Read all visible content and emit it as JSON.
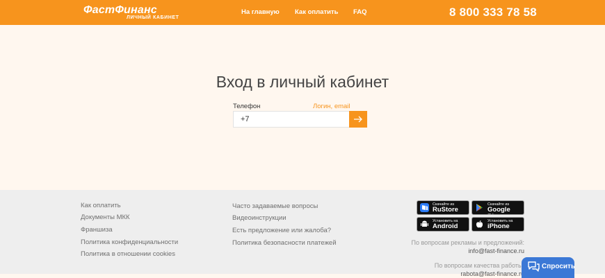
{
  "header": {
    "logo_main": "ФастФинанс",
    "logo_sub": "ЛИЧНЫЙ КАБИНЕТ",
    "nav": [
      "На главную",
      "Как оплатить",
      "FAQ"
    ],
    "phone": "8 800 333 78 58"
  },
  "login": {
    "title": "Вход в личный кабинет",
    "phone_label": "Телефон",
    "login_email_link": "Логин, email",
    "phone_value": "+7"
  },
  "footer": {
    "col1": [
      "Как оплатить",
      "Документы МКК",
      "Франшиза",
      "Политика конфиденциальности",
      "Политика в отношении cookies"
    ],
    "col2": [
      "Часто задаваемые вопросы",
      "Видеоинструкции",
      "Есть предложение или жалоба?",
      "Политика безопасности платежей"
    ],
    "stores": [
      {
        "small": "Скачайте из",
        "big": "RuStore",
        "icon": "rustore-icon"
      },
      {
        "small": "Скачайте из",
        "big": "Google Play",
        "icon": "google-play-icon"
      },
      {
        "small": "Установить на",
        "big": "Android",
        "icon": "android-icon"
      },
      {
        "small": "Установить на",
        "big": "iPhone",
        "icon": "apple-icon"
      }
    ],
    "ads_text": "По вопросам рекламы и предложений:",
    "ads_email": "info@fast-finance.ru",
    "quality_text": "По вопросам качества работы:",
    "quality_email": "rabota@fast-finance.ru"
  },
  "chat": {
    "label": "Спросить"
  },
  "colors": {
    "accent": "#f7941d",
    "chat": "#3b78d6"
  }
}
